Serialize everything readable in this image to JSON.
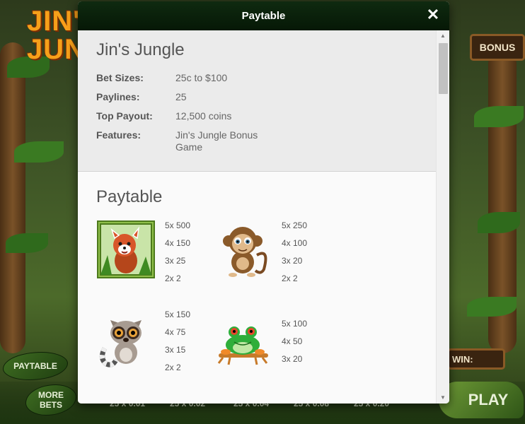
{
  "background": {
    "logo_line1": "JIN'S",
    "logo_line2": "JUNGLE",
    "bonus_sign": "BONUS",
    "win_sign": "WIN:",
    "paytable_button": "PAYTABLE",
    "more_bets_button": "MORE BETS",
    "play_button": "PLAY",
    "bet_options": [
      "25 x 0.01",
      "25 x 0.02",
      "25 x 0.04",
      "25 x 0.08",
      "25 x 0.20"
    ]
  },
  "modal": {
    "title": "Paytable",
    "close_icon": "close-icon",
    "game_title": "Jin's Jungle",
    "info": [
      {
        "label": "Bet Sizes:",
        "value": "25c to $100"
      },
      {
        "label": "Paylines:",
        "value": "25"
      },
      {
        "label": "Top Payout:",
        "value": "12,500 coins"
      },
      {
        "label": "Features:",
        "value": "Jin's Jungle Bonus Game"
      }
    ],
    "paytable_title": "Paytable",
    "symbols": [
      {
        "name": "red-panda",
        "payouts": [
          "5x 500",
          "4x 150",
          "3x 25",
          "2x 2"
        ]
      },
      {
        "name": "monkey",
        "payouts": [
          "5x 250",
          "4x 100",
          "3x 20",
          "2x 2"
        ]
      },
      {
        "name": "lemur",
        "payouts": [
          "5x 150",
          "4x 75",
          "3x 15",
          "2x 2"
        ]
      },
      {
        "name": "frog",
        "payouts": [
          "5x 100",
          "4x 50",
          "3x 20"
        ]
      }
    ]
  },
  "colors": {
    "header_bg": "#0f2a10",
    "info_bg": "#ebebeb",
    "text": "#555555"
  }
}
